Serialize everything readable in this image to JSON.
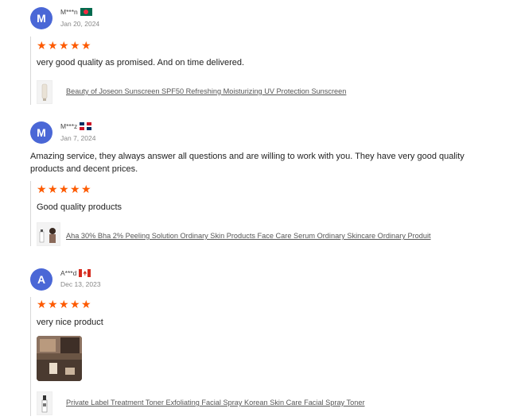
{
  "reviews": [
    {
      "avatar_letter": "M",
      "user": "M***n",
      "flag": "bangladesh-flag",
      "date": "Jan 20, 2024",
      "rating": 5,
      "comment": "very good quality as promised. And on time delivered.",
      "product": "Beauty of Joseon Sunscreen SPF50 Refreshing Moisturizing UV Protection Sunscreen"
    },
    {
      "avatar_letter": "M",
      "user": "M***z",
      "flag": "dominican-republic-flag",
      "date": "Jan 7, 2024",
      "seller_reply": "Amazing service, they always answer all questions and are willing to work with you. They have very good quality products and decent prices.",
      "rating": 5,
      "comment": "Good quality products",
      "product": "Aha 30% Bha 2% Peeling Solution Ordinary Skin Products Face Care Serum Ordinary Skincare Ordinary Produit"
    },
    {
      "avatar_letter": "A",
      "user": "A***d",
      "flag": "canada-flag",
      "date": "Dec 13, 2023",
      "rating": 5,
      "comment": "very nice product",
      "product": "Private Label Treatment Toner Exfoliating Facial Spray Korean Skin Care Facial Spray Toner"
    }
  ],
  "colors": {
    "avatar": "#4a67d6",
    "star": "#fd5a00"
  },
  "star_glyph": "★"
}
